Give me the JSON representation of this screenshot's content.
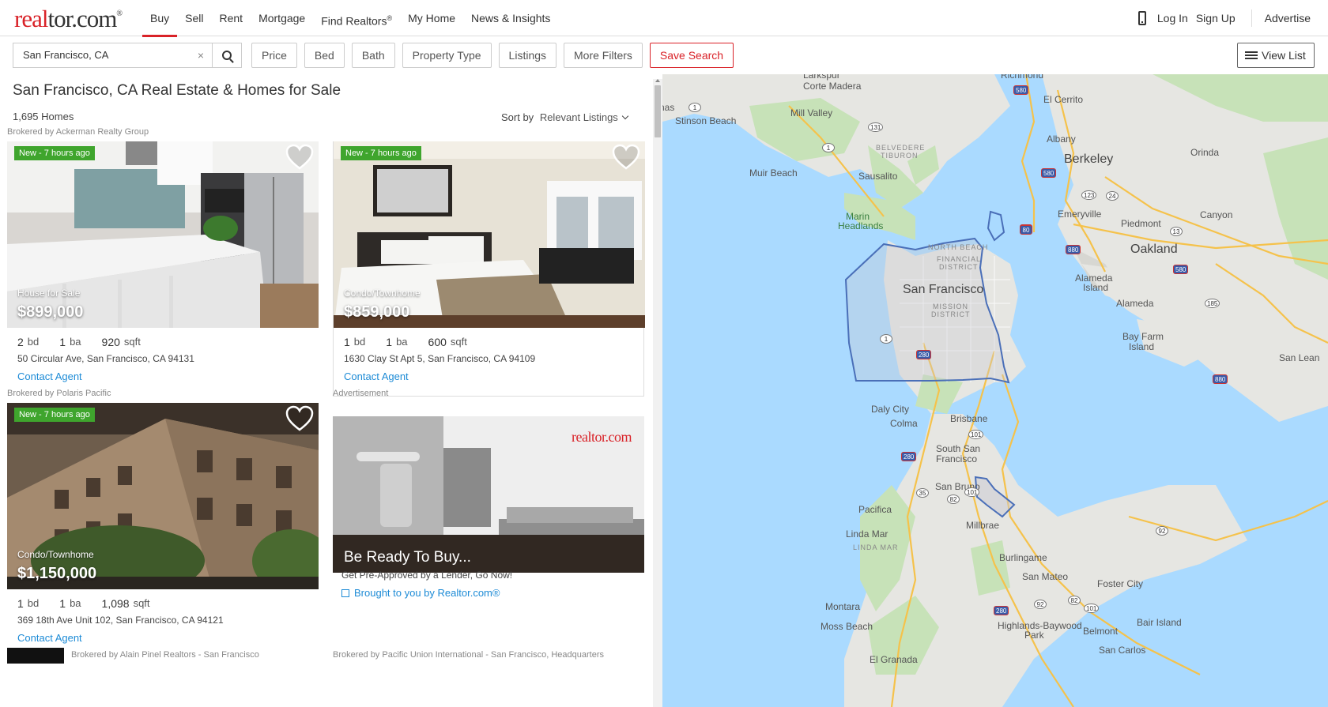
{
  "brand": {
    "logo_red": "real",
    "logo_rest": "tor.com",
    "logo_tm": "®",
    "color": "#d92228"
  },
  "nav": {
    "items": [
      {
        "label": "Buy",
        "active": true
      },
      {
        "label": "Sell"
      },
      {
        "label": "Rent"
      },
      {
        "label": "Mortgage"
      },
      {
        "label": "Find Realtors",
        "sup": "®"
      },
      {
        "label": "My Home"
      },
      {
        "label": "News & Insights"
      }
    ],
    "login": "Log In",
    "signup": "Sign Up",
    "advertise": "Advertise"
  },
  "search": {
    "value": "San Francisco, CA",
    "clear": "×",
    "filters": [
      "Price",
      "Bed",
      "Bath",
      "Property Type",
      "Listings",
      "More Filters"
    ],
    "save": "Save Search",
    "view_list": "View List"
  },
  "results": {
    "title": "San Francisco, CA Real Estate & Homes for Sale",
    "count": "1,695 Homes",
    "sort_label": "Sort by",
    "sort_value": "Relevant Listings"
  },
  "listings": [
    {
      "broker": "Brokered by Ackerman Realty Group",
      "badge": "New - 7 hours ago",
      "type": "House for Sale",
      "price": "$899,000",
      "bd": "2",
      "bd_unit": "bd",
      "ba": "1",
      "ba_unit": "ba",
      "sqft": "920",
      "sqft_unit": "sqft",
      "address": "50 Circular Ave, San Francisco, CA 94131",
      "contact": "Contact Agent"
    },
    {
      "broker": "",
      "badge": "New - 7 hours ago",
      "type": "Condo/Townhome",
      "price": "$859,000",
      "bd": "1",
      "bd_unit": "bd",
      "ba": "1",
      "ba_unit": "ba",
      "sqft": "600",
      "sqft_unit": "sqft",
      "address": "1630 Clay St Apt 5, San Francisco, CA 94109",
      "contact": "Contact Agent"
    },
    {
      "broker": "Brokered by Polaris Pacific",
      "badge": "New - 7 hours ago",
      "type": "Condo/Townhome",
      "price": "$1,150,000",
      "bd": "1",
      "bd_unit": "bd",
      "ba": "1",
      "ba_unit": "ba",
      "sqft": "1,098",
      "sqft_unit": "sqft",
      "address": "369 18th Ave Unit 102, San Francisco, CA 94121",
      "contact": "Contact Agent"
    }
  ],
  "ad": {
    "label": "Advertisement",
    "logo": "realtor.com",
    "headline": "Be Ready To Buy...",
    "sub": "Get Pre-Approved by a Lender, Go Now!",
    "link": "Brought to you by Realtor.com®"
  },
  "more_brokers": [
    "Brokered by Alain Pinel Realtors - San Francisco",
    "Brokered by Pacific Union International - San Francisco, Headquarters"
  ],
  "map": {
    "labels": {
      "larkspur": "Larkspur",
      "corte_madera": "Corte Madera",
      "richmond": "Richmond",
      "el_cerrito": "El Cerrito",
      "bolinas": "Bolinas",
      "stinson": "Stinson Beach",
      "mill_valley": "Mill Valley",
      "albany": "Albany",
      "berkeley": "Berkeley",
      "orinda": "Orinda",
      "belvedere": "BELVEDERE",
      "tiburon": "TIBURON",
      "muir": "Muir Beach",
      "sausalito": "Sausalito",
      "emeryville": "Emeryville",
      "canyon": "Canyon",
      "piedmont": "Piedmont",
      "marin": "Marin",
      "headlands": "Headlands",
      "oakland": "Oakland",
      "north_beach": "NORTH BEACH",
      "financial": "FINANCIAL",
      "district": "DISTRICT",
      "alameda_island1": "Alameda",
      "alameda_island2": "Island",
      "sf": "San Francisco",
      "mission1": "MISSION",
      "mission2": "DISTRICT",
      "alameda": "Alameda",
      "bay_farm1": "Bay Farm",
      "bay_farm2": "Island",
      "san_lean": "San Lean",
      "daly": "Daly City",
      "colma": "Colma",
      "brisbane": "Brisbane",
      "ssf1": "South San",
      "ssf2": "Francisco",
      "san_bruno": "San Bruno",
      "pacifica": "Pacifica",
      "millbrae": "Millbrae",
      "linda_mar": "Linda Mar",
      "linda_mar2": "LINDA MAR",
      "burlingame": "Burlingame",
      "san_mateo": "San Mateo",
      "foster": "Foster City",
      "montara": "Montara",
      "moss": "Moss Beach",
      "highlands1": "Highlands-Baywood",
      "highlands2": "Park",
      "bair": "Bair Island",
      "belmont": "Belmont",
      "san_carlos": "San Carlos",
      "el_granada": "El Granada"
    },
    "shields": [
      "580",
      "1",
      "131",
      "1",
      "580",
      "123",
      "24",
      "80",
      "80",
      "880",
      "13",
      "580",
      "185",
      "880",
      "1",
      "280",
      "101",
      "280",
      "35",
      "82",
      "101",
      "92",
      "92",
      "101",
      "280",
      "82"
    ]
  },
  "colors": {
    "accent": "#d92228",
    "link": "#1d8bd6",
    "badge": "#3fa52d",
    "water": "#aadaff",
    "land": "#e8e8e8",
    "park": "#c4e3b5"
  }
}
